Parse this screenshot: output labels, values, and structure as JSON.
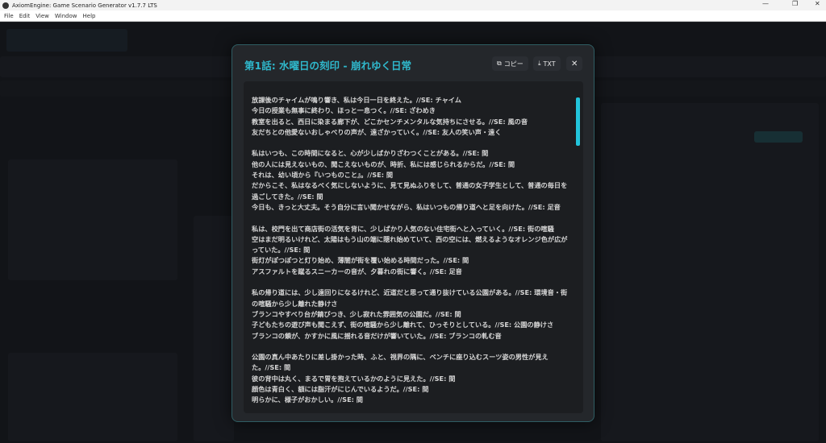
{
  "window": {
    "title": "AxiomEngine: Game Scenario Generator v1.7.7 LTS"
  },
  "menu": [
    "File",
    "Edit",
    "View",
    "Window",
    "Help"
  ],
  "modal": {
    "title": "第1話: 水曜日の刻印 - 崩れゆく日常",
    "copy_label": "コピー",
    "txt_label": "TXT",
    "scroll_position": 0,
    "lines": [
      "放課後のチャイムが鳴り響き、私は今日一日を終えた。//SE: チャイム",
      "今日の授業も無事に終わり、ほっと一息つく。//SE: ざわめき",
      "教室を出ると、西日に染まる廊下が、どこかセンチメンタルな気持ちにさせる。//SE: 風の音",
      "友だちとの他愛ないおしゃべりの声が、遠ざかっていく。//SE: 友人の笑い声・遠く",
      "",
      "私はいつも、この時間になると、心が少しばかりざわつくことがある。//SE: 間",
      "他の人には見えないもの、聞こえないものが、時折、私には感じられるからだ。//SE: 間",
      "それは、幼い頃から『いつものこと』。//SE: 間",
      "だからこそ、私はなるべく気にしないように、見て見ぬふりをして、普通の女子学生として、普通の毎日を過ごしてきた。//SE: 間",
      "今日も、きっと大丈夫。そう自分に言い聞かせながら、私はいつもの帰り道へと足を向けた。//SE: 足音",
      "",
      "私は、校門を出て商店街の活気を背に、少しばかり人気のない住宅街へと入っていく。//SE: 街の喧騒",
      "空はまだ明るいけれど、太陽はもう山の端に隠れ始めていて、西の空には、燃えるようなオレンジ色が広がっていた。//SE: 間",
      "街灯がぽつぽつと灯り始め、薄闇が街を覆い始める時間だった。//SE: 間",
      "アスファルトを蹴るスニーカーの音が、夕暮れの街に響く。//SE: 足音",
      "",
      "私の帰り道には、少し遠回りになるけれど、近道だと思って通り抜けている公園がある。//SE: 環境音・街の喧騒から少し離れた静けさ",
      "ブランコやすべり台が錆びつき、少し寂れた雰囲気の公園だ。//SE: 間",
      "子どもたちの遊び声も聞こえず、街の喧騒から少し離れて、ひっそりとしている。//SE: 公園の静けさ",
      "ブランコの鎖が、かすかに風に揺れる音だけが響いていた。//SE: ブランコの軋む音",
      "",
      "公園の真ん中あたりに差し掛かった時、ふと、視界の隅に、ベンチに座り込むスーツ姿の男性が見えた。//SE: 間",
      "彼の背中は丸く、まるで胃を抱えているかのように見えた。//SE: 間",
      "顔色は青白く、額には脂汗がにじんでいるようだ。//SE: 間",
      "明らかに、様子がおかしい。//SE: 間"
    ]
  }
}
